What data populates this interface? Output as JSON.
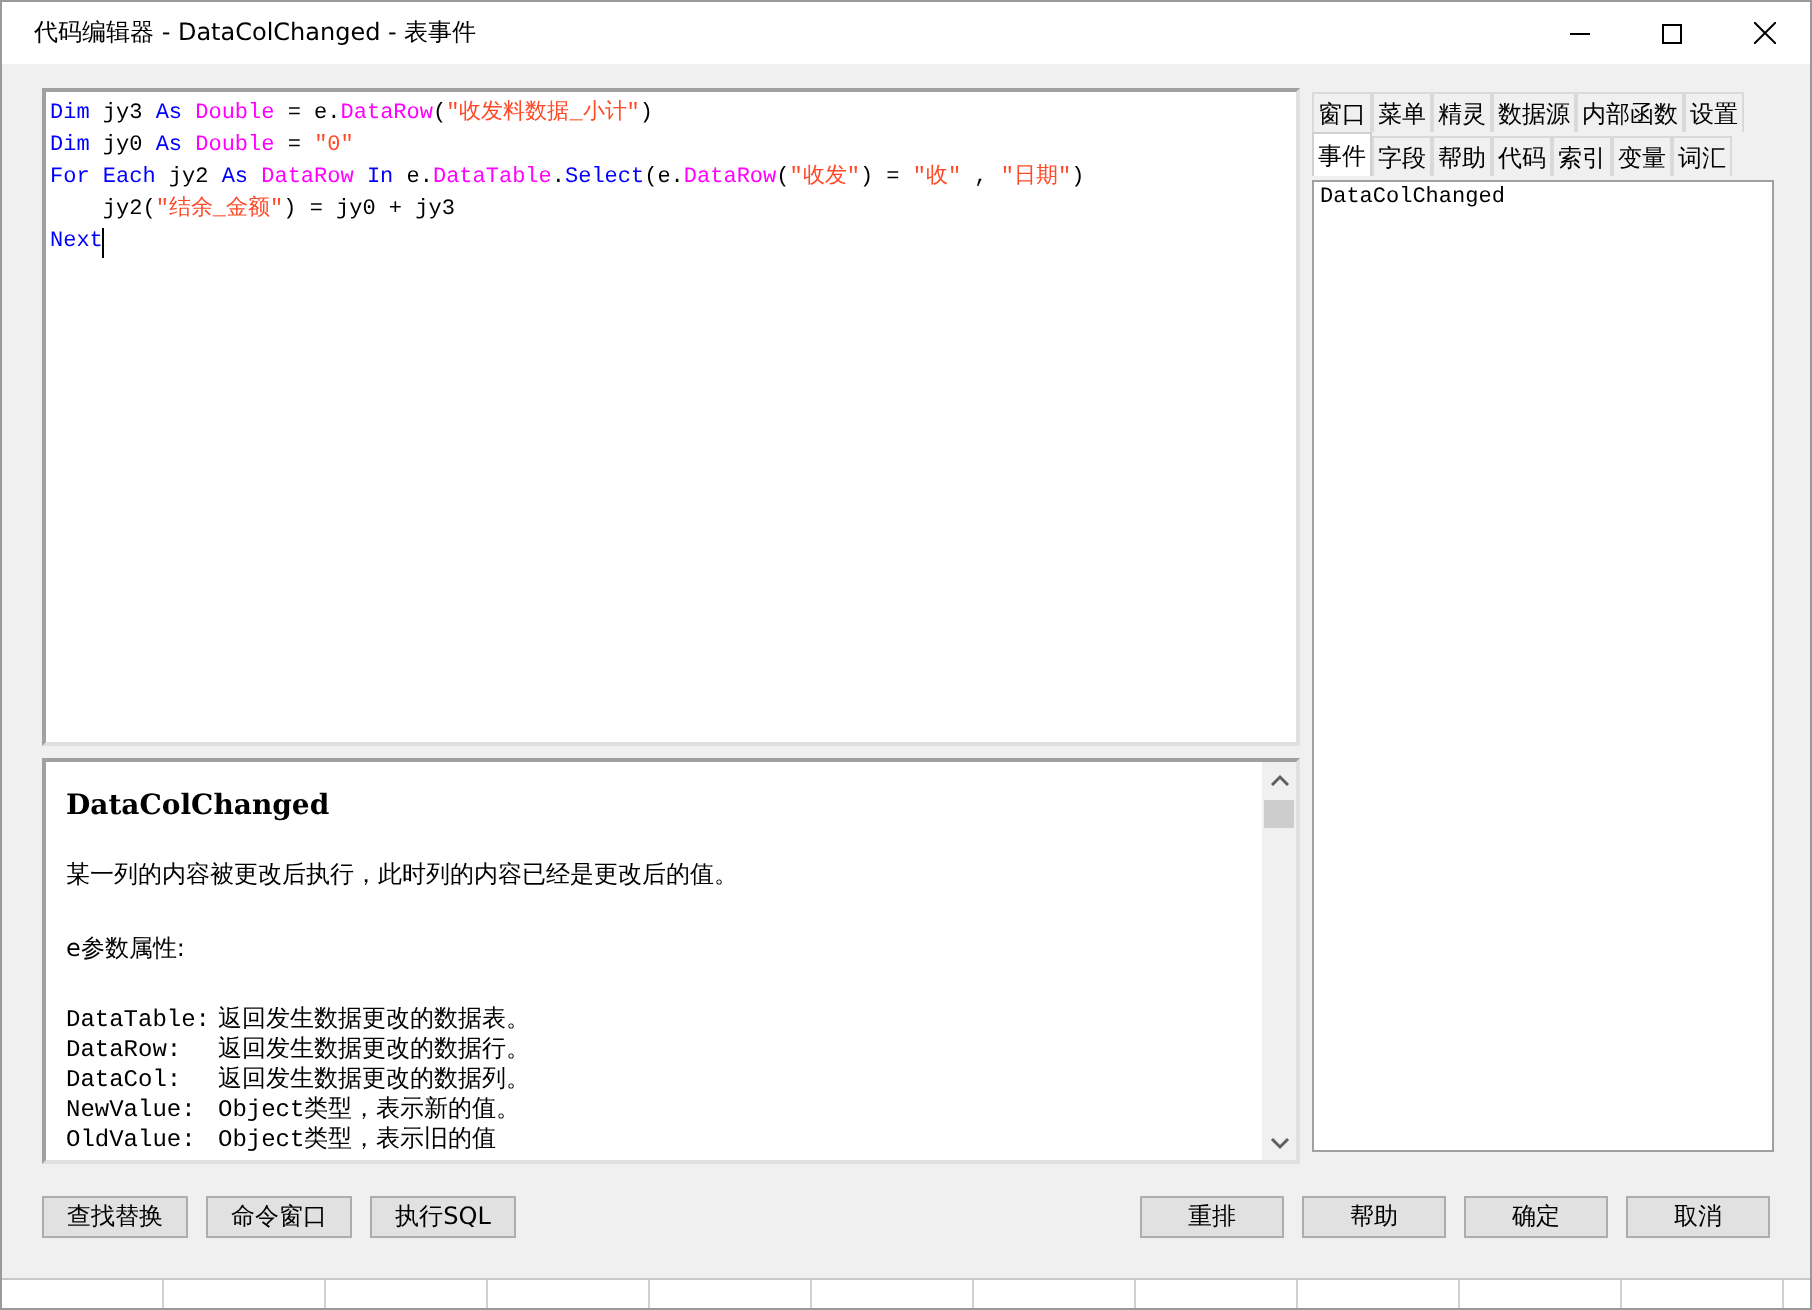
{
  "window": {
    "title": "代码编辑器 - DataColChanged - 表事件"
  },
  "code_lines": [
    {
      "tokens": [
        {
          "kind": "keyword",
          "text": "Dim"
        },
        {
          "kind": "plain",
          "text": " jy3 "
        },
        {
          "kind": "keyword",
          "text": "As"
        },
        {
          "kind": "type",
          "text": " Double"
        },
        {
          "kind": "plain",
          "text": " = e."
        },
        {
          "kind": "type",
          "text": "DataRow"
        },
        {
          "kind": "plain",
          "text": "("
        },
        {
          "kind": "string",
          "text": "\"收发料数据_小计\""
        },
        {
          "kind": "plain",
          "text": ")"
        }
      ]
    },
    {
      "tokens": [
        {
          "kind": "keyword",
          "text": "Dim"
        },
        {
          "kind": "plain",
          "text": " jy0 "
        },
        {
          "kind": "keyword",
          "text": "As"
        },
        {
          "kind": "type",
          "text": " Double"
        },
        {
          "kind": "plain",
          "text": " = "
        },
        {
          "kind": "string",
          "text": "\"0\""
        }
      ]
    },
    {
      "tokens": [
        {
          "kind": "keyword",
          "text": "For Each"
        },
        {
          "kind": "plain",
          "text": " jy2 "
        },
        {
          "kind": "keyword",
          "text": "As"
        },
        {
          "kind": "type",
          "text": " DataRow"
        },
        {
          "kind": "keyword",
          "text": " In"
        },
        {
          "kind": "plain",
          "text": " e."
        },
        {
          "kind": "type",
          "text": "DataTable"
        },
        {
          "kind": "plain",
          "text": "."
        },
        {
          "kind": "keyword",
          "text": "Select"
        },
        {
          "kind": "plain",
          "text": "(e."
        },
        {
          "kind": "type",
          "text": "DataRow"
        },
        {
          "kind": "plain",
          "text": "("
        },
        {
          "kind": "string",
          "text": "\"收发\""
        },
        {
          "kind": "plain",
          "text": ") = "
        },
        {
          "kind": "string",
          "text": "\"收\""
        },
        {
          "kind": "plain",
          "text": " , "
        },
        {
          "kind": "string",
          "text": "\"日期\""
        },
        {
          "kind": "plain",
          "text": ")"
        }
      ]
    },
    {
      "tokens": [
        {
          "kind": "plain",
          "text": "    jy2("
        },
        {
          "kind": "string",
          "text": "\"结余_金额\""
        },
        {
          "kind": "plain",
          "text": ") = jy0 + jy3"
        }
      ]
    },
    {
      "tokens": [
        {
          "kind": "keyword",
          "text": "Next"
        }
      ],
      "caret": true
    }
  ],
  "help": {
    "title": "DataColChanged",
    "description": "某一列的内容被更改后执行，此时列的内容已经是更改后的值。",
    "params_heading": "e参数属性:",
    "params": [
      {
        "name": "DataTable:",
        "text": "返回发生数据更改的数据表。"
      },
      {
        "name": "DataRow:",
        "text": "返回发生数据更改的数据行。"
      },
      {
        "name": "DataCol:",
        "text": "返回发生数据更改的数据列。"
      },
      {
        "name": "NewValue:",
        "text": "Object类型，表示新的值。"
      },
      {
        "name": "OldValue:",
        "text": "Object类型，表示旧的值"
      }
    ]
  },
  "side_tabs": [
    [
      {
        "label": "窗口",
        "selected": false
      },
      {
        "label": "菜单",
        "selected": false
      },
      {
        "label": "精灵",
        "selected": false
      },
      {
        "label": "数据源",
        "selected": false
      },
      {
        "label": "内部函数",
        "selected": false
      },
      {
        "label": "设置",
        "selected": false
      }
    ],
    [
      {
        "label": "事件",
        "selected": true
      },
      {
        "label": "字段",
        "selected": false
      },
      {
        "label": "帮助",
        "selected": false
      },
      {
        "label": "代码",
        "selected": false
      },
      {
        "label": "索引",
        "selected": false
      },
      {
        "label": "变量",
        "selected": false
      },
      {
        "label": "词汇",
        "selected": false
      }
    ]
  ],
  "event_list": [
    "DataColChanged"
  ],
  "left_buttons": [
    "查找替换",
    "命令窗口",
    "执行SQL"
  ],
  "right_buttons": [
    "重排",
    "帮助",
    "确定",
    "取消"
  ]
}
